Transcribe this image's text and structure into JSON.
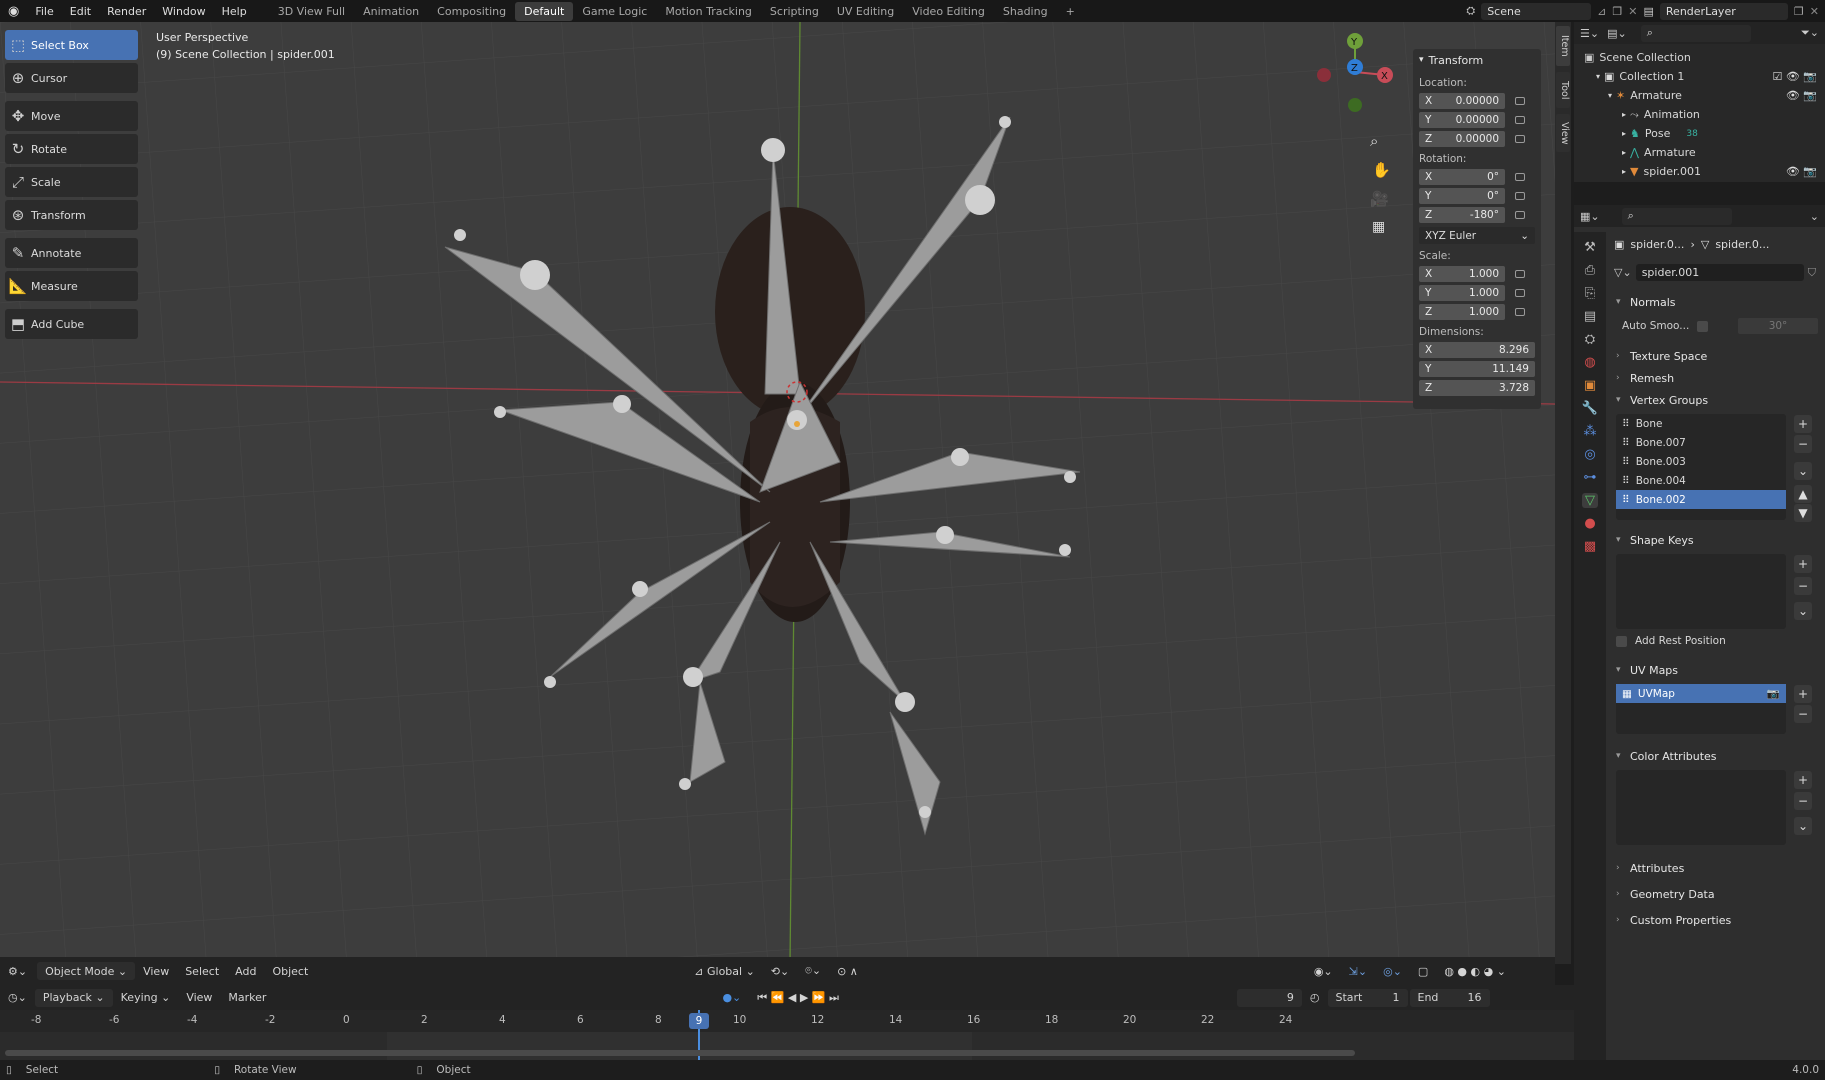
{
  "topbar": {
    "menu": [
      "File",
      "Edit",
      "Render",
      "Window",
      "Help"
    ],
    "workspaces": [
      "3D View Full",
      "Animation",
      "Compositing",
      "Default",
      "Game Logic",
      "Motion Tracking",
      "Scripting",
      "UV Editing",
      "Video Editing",
      "Shading"
    ],
    "active_workspace": "Default",
    "add_workspace": "+",
    "scene": "Scene",
    "view_layer": "RenderLayer"
  },
  "toolbar": {
    "tools": [
      "Select Box",
      "Cursor",
      "Move",
      "Rotate",
      "Scale",
      "Transform",
      "Annotate",
      "Measure",
      "Add Cube"
    ],
    "active": "Select Box"
  },
  "viewport": {
    "perspective": "User Perspective",
    "context": "(9) Scene Collection | spider.001",
    "gizmo": {
      "y": "Y",
      "z": "Z",
      "x": "X"
    },
    "tabs": [
      "Item",
      "Tool",
      "View"
    ]
  },
  "npanel": {
    "title": "Transform",
    "location_label": "Location:",
    "location": [
      {
        "axis": "X",
        "value": "0.00000"
      },
      {
        "axis": "Y",
        "value": "0.00000"
      },
      {
        "axis": "Z",
        "value": "0.00000"
      }
    ],
    "rotation_label": "Rotation:",
    "rotation": [
      {
        "axis": "X",
        "value": "0°"
      },
      {
        "axis": "Y",
        "value": "0°"
      },
      {
        "axis": "Z",
        "value": "-180°"
      }
    ],
    "rotation_mode": "XYZ Euler",
    "scale_label": "Scale:",
    "scale": [
      {
        "axis": "X",
        "value": "1.000"
      },
      {
        "axis": "Y",
        "value": "1.000"
      },
      {
        "axis": "Z",
        "value": "1.000"
      }
    ],
    "dimensions_label": "Dimensions:",
    "dimensions": [
      {
        "axis": "X",
        "value": "8.296"
      },
      {
        "axis": "Y",
        "value": "11.149"
      },
      {
        "axis": "Z",
        "value": "3.728"
      }
    ]
  },
  "outliner": {
    "rows": [
      "Scene Collection",
      "Collection 1",
      "Armature",
      "Animation",
      "Pose",
      "Armature",
      "spider.001"
    ],
    "pose_count": "38"
  },
  "properties": {
    "breadcrumb1": "spider.0...",
    "breadcrumb2": "spider.0...",
    "mesh_name": "spider.001",
    "normals": "Normals",
    "auto_smooth": "Auto Smoo...",
    "auto_smooth_angle": "30°",
    "texture_space": "Texture Space",
    "remesh": "Remesh",
    "vertex_groups": "Vertex Groups",
    "vgroups": [
      "Bone",
      "Bone.007",
      "Bone.003",
      "Bone.004",
      "Bone.002"
    ],
    "vgroup_selected": "Bone.002",
    "shape_keys": "Shape Keys",
    "add_rest_position": "Add Rest Position",
    "uv_maps": "UV Maps",
    "uvmap": "UVMap",
    "color_attributes": "Color Attributes",
    "attributes": "Attributes",
    "geometry_data": "Geometry Data",
    "custom_properties": "Custom Properties"
  },
  "header3d": {
    "mode": "Object Mode",
    "menus": [
      "View",
      "Select",
      "Add",
      "Object"
    ],
    "orientation": "Global"
  },
  "timeline_header": {
    "menus": [
      "Playback",
      "Keying",
      "View",
      "Marker"
    ],
    "current_frame": "9",
    "start_label": "Start",
    "start": "1",
    "end_label": "End",
    "end": "16"
  },
  "timeline": {
    "ticks": [
      "-8",
      "-6",
      "-4",
      "-2",
      "0",
      "2",
      "4",
      "6",
      "8",
      "9",
      "10",
      "12",
      "14",
      "16",
      "18",
      "20",
      "22",
      "24"
    ],
    "playhead": "9"
  },
  "status": {
    "select": "Select",
    "rotate": "Rotate View",
    "object": "Object",
    "version": "4.0.0"
  }
}
